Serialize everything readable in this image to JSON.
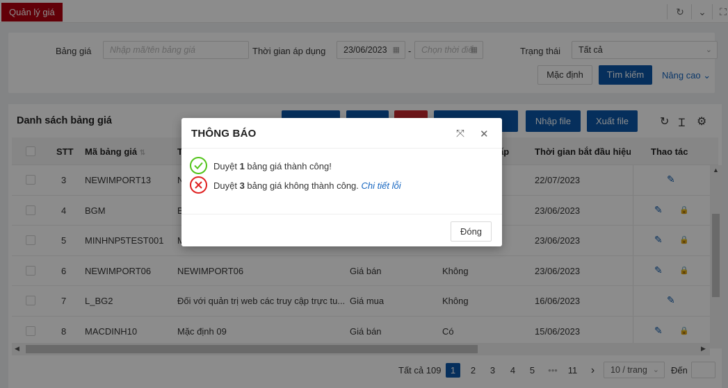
{
  "tab": {
    "label": "Quản lý giá"
  },
  "filter": {
    "price_table_label": "Bảng giá",
    "price_table_placeholder": "Nhập mã/tên bảng giá",
    "time_label": "Thời gian áp dụng",
    "date_from": "23/06/2023",
    "date_sep": "-",
    "date_to_placeholder": "Chọn thời điể",
    "status_label": "Trạng thái",
    "status_value": "Tất cả",
    "default_btn": "Mặc định",
    "search_btn": "Tìm kiếm",
    "advanced_link": "Nâng cao"
  },
  "list": {
    "title": "Danh sách bảng giá",
    "import_btn": "Nhập file",
    "export_btn": "Xuất file"
  },
  "table": {
    "headers": {
      "stt": "STT",
      "code": "Mã bảng giá",
      "name": "T",
      "type": "",
      "config": "ấp",
      "start": "Thời gian bắt đầu hiệu",
      "actions": "Thao tác"
    },
    "rows": [
      {
        "stt": "3",
        "code": "NEWIMPORT13",
        "name": "N",
        "type": "",
        "flag": "",
        "date": "22/07/2023",
        "lock": false
      },
      {
        "stt": "4",
        "code": "BGM",
        "name": "B",
        "type": "",
        "flag": "",
        "date": "23/06/2023",
        "lock": true
      },
      {
        "stt": "5",
        "code": "MINHNP5TEST001",
        "name": "M",
        "type": "",
        "flag": "",
        "date": "23/06/2023",
        "lock": true
      },
      {
        "stt": "6",
        "code": "NEWIMPORT06",
        "name": "NEWIMPORT06",
        "type": "Giá bán",
        "flag": "Không",
        "date": "23/06/2023",
        "lock": true
      },
      {
        "stt": "7",
        "code": "L_BG2",
        "name": "Đối với quản trị web các truy cập trực tu...",
        "type": "Giá mua",
        "flag": "Không",
        "date": "16/06/2023",
        "lock": false
      },
      {
        "stt": "8",
        "code": "MACDINH10",
        "name": "Mặc định 09",
        "type": "Giá bán",
        "flag": "Có",
        "date": "15/06/2023",
        "lock": true
      }
    ]
  },
  "pagination": {
    "total": "Tất cả 109",
    "pages": [
      "1",
      "2",
      "3",
      "4",
      "5"
    ],
    "ellipsis": "•••",
    "last": "11",
    "next": "›",
    "page_size": "10 / trang",
    "goto_label": "Đến"
  },
  "modal": {
    "title": "THÔNG BÁO",
    "success_prefix": "Duyệt ",
    "success_count": "1",
    "success_suffix": " bảng giá thành công!",
    "fail_prefix": "Duyệt ",
    "fail_count": "3",
    "fail_suffix": " bảng giá không thành công. ",
    "fail_link": "Chi tiết lỗi",
    "close_btn": "Đóng"
  },
  "colors": {
    "brand_red": "#b3000f",
    "primary_blue": "#0b57a8",
    "success_green": "#52c41a",
    "error_red": "#e02020"
  }
}
